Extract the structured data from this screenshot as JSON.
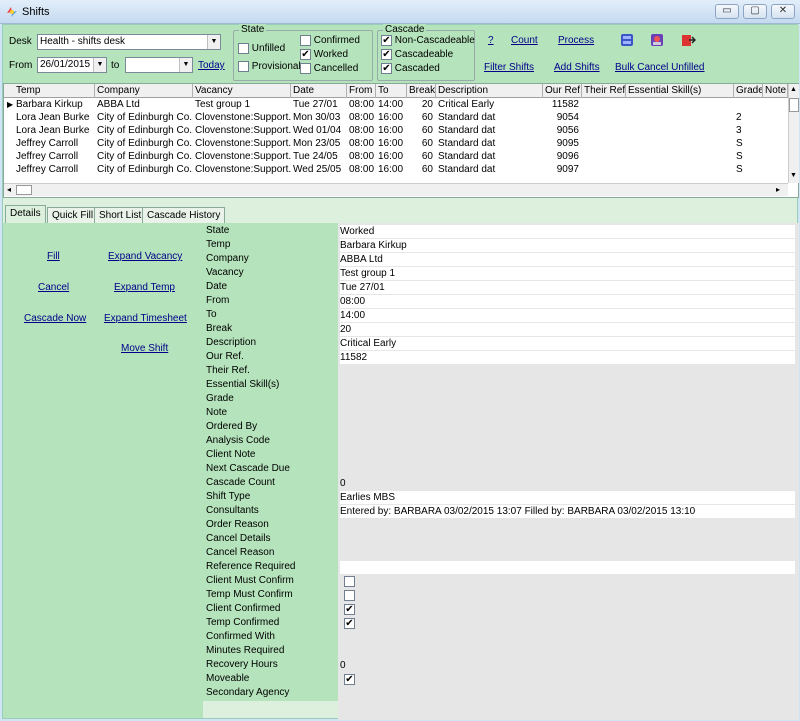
{
  "window": {
    "title": "Shifts",
    "minimize_label": "▭",
    "maximize_label": "▢",
    "close_label": "✕"
  },
  "filters": {
    "desk_label": "Desk",
    "desk_value": "Health - shifts desk",
    "from_label": "From",
    "from_value": "26/01/2015",
    "to_label": "to",
    "to_value": "",
    "today_link": "Today"
  },
  "state": {
    "title": "State",
    "unfilled": "Unfilled",
    "provisional": "Provisional",
    "confirmed": "Confirmed",
    "worked": "Worked",
    "cancelled": "Cancelled",
    "unfilled_checked": false,
    "provisional_checked": false,
    "confirmed_checked": false,
    "worked_checked": true,
    "cancelled_checked": false
  },
  "cascade": {
    "title": "Cascade",
    "non_cascadeable": "Non-Cascadeable",
    "cascadeable": "Cascadeable",
    "cascaded": "Cascaded",
    "non_cascadeable_checked": true,
    "cascadeable_checked": true,
    "cascaded_checked": true
  },
  "actions": {
    "help": "?",
    "count": "Count",
    "process": "Process",
    "filter_shifts": "Filter Shifts",
    "add_shifts": "Add Shifts",
    "bulk_cancel": "Bulk Cancel Unfilled"
  },
  "grid": {
    "columns": [
      "Temp",
      "Company",
      "Vacancy",
      "Date",
      "From",
      "To",
      "Break",
      "Description",
      "Our Ref.",
      "Their Ref.",
      "Essential Skill(s)",
      "Grade",
      "Note"
    ],
    "rows": [
      [
        "Barbara Kirkup",
        "ABBA Ltd",
        "Test group 1",
        "Tue 27/01",
        "08:00",
        "14:00",
        "20",
        "Critical Early",
        "11582",
        "",
        "",
        "",
        ""
      ],
      [
        "Lora Jean Burke",
        "City of Edinburgh Co...",
        "Clovenstone:Support...",
        "Mon 30/03",
        "08:00",
        "16:00",
        "60",
        "Standard dat",
        "9054",
        "",
        "",
        "2",
        ""
      ],
      [
        "Lora Jean Burke",
        "City of Edinburgh Co...",
        "Clovenstone:Support...",
        "Wed 01/04",
        "08:00",
        "16:00",
        "60",
        "Standard dat",
        "9056",
        "",
        "",
        "3",
        ""
      ],
      [
        "Jeffrey Carroll",
        "City of Edinburgh Co...",
        "Clovenstone:Support...",
        "Mon 23/05",
        "08:00",
        "16:00",
        "60",
        "Standard dat",
        "9095",
        "",
        "",
        "S",
        ""
      ],
      [
        "Jeffrey Carroll",
        "City of Edinburgh Co...",
        "Clovenstone:Support...",
        "Tue 24/05",
        "08:00",
        "16:00",
        "60",
        "Standard dat",
        "9096",
        "",
        "",
        "S",
        ""
      ],
      [
        "Jeffrey Carroll",
        "City of Edinburgh Co...",
        "Clovenstone:Support...",
        "Wed 25/05",
        "08:00",
        "16:00",
        "60",
        "Standard dat",
        "9097",
        "",
        "",
        "S",
        ""
      ]
    ]
  },
  "tabs": [
    "Details",
    "Quick Fill",
    "Short List",
    "Cascade History"
  ],
  "details_actions": {
    "fill": "Fill",
    "expand_vacancy": "Expand Vacancy",
    "cancel": "Cancel",
    "expand_temp": "Expand Temp",
    "cascade_now": "Cascade Now",
    "expand_timesheet": "Expand Timesheet",
    "move_shift": "Move Shift"
  },
  "details": [
    {
      "label": "State",
      "value": "Worked"
    },
    {
      "label": "Temp",
      "value": "Barbara Kirkup"
    },
    {
      "label": "Company",
      "value": "ABBA Ltd"
    },
    {
      "label": "Vacancy",
      "value": "Test group 1"
    },
    {
      "label": "Date",
      "value": "Tue 27/01"
    },
    {
      "label": "From",
      "value": "08:00"
    },
    {
      "label": "To",
      "value": "14:00"
    },
    {
      "label": "Break",
      "value": "20"
    },
    {
      "label": "Description",
      "value": "Critical Early"
    },
    {
      "label": "Our Ref.",
      "value": "11582"
    },
    {
      "label": "Their Ref.",
      "value": ""
    },
    {
      "label": "Essential Skill(s)",
      "value": ""
    },
    {
      "label": "Grade",
      "value": ""
    },
    {
      "label": "Note",
      "value": ""
    },
    {
      "label": "Ordered By",
      "value": ""
    },
    {
      "label": "Analysis Code",
      "value": ""
    },
    {
      "label": "Client Note",
      "value": ""
    },
    {
      "label": "Next Cascade Due",
      "value": ""
    },
    {
      "label": "Cascade Count",
      "value": "0"
    },
    {
      "label": "Shift Type",
      "value": "Earlies MBS"
    },
    {
      "label": "Consultants",
      "value": "Entered by: BARBARA 03/02/2015 13:07  Filled by: BARBARA 03/02/2015 13:10"
    },
    {
      "label": "Order Reason",
      "value": ""
    },
    {
      "label": "Cancel Details",
      "value": ""
    },
    {
      "label": "Cancel Reason",
      "value": ""
    },
    {
      "label": "Reference Required",
      "value": ""
    },
    {
      "label": "Client Must Confirm",
      "value": "",
      "checkbox": false
    },
    {
      "label": "Temp Must Confirm",
      "value": "",
      "checkbox": false
    },
    {
      "label": "Client Confirmed",
      "value": "",
      "checkbox": true
    },
    {
      "label": "Temp Confirmed",
      "value": "",
      "checkbox": true
    },
    {
      "label": "Confirmed With",
      "value": ""
    },
    {
      "label": "Minutes Required",
      "value": ""
    },
    {
      "label": "Recovery Hours",
      "value": "0"
    },
    {
      "label": "Moveable",
      "value": "",
      "checkbox": true
    },
    {
      "label": "Secondary Agency",
      "value": ""
    }
  ]
}
